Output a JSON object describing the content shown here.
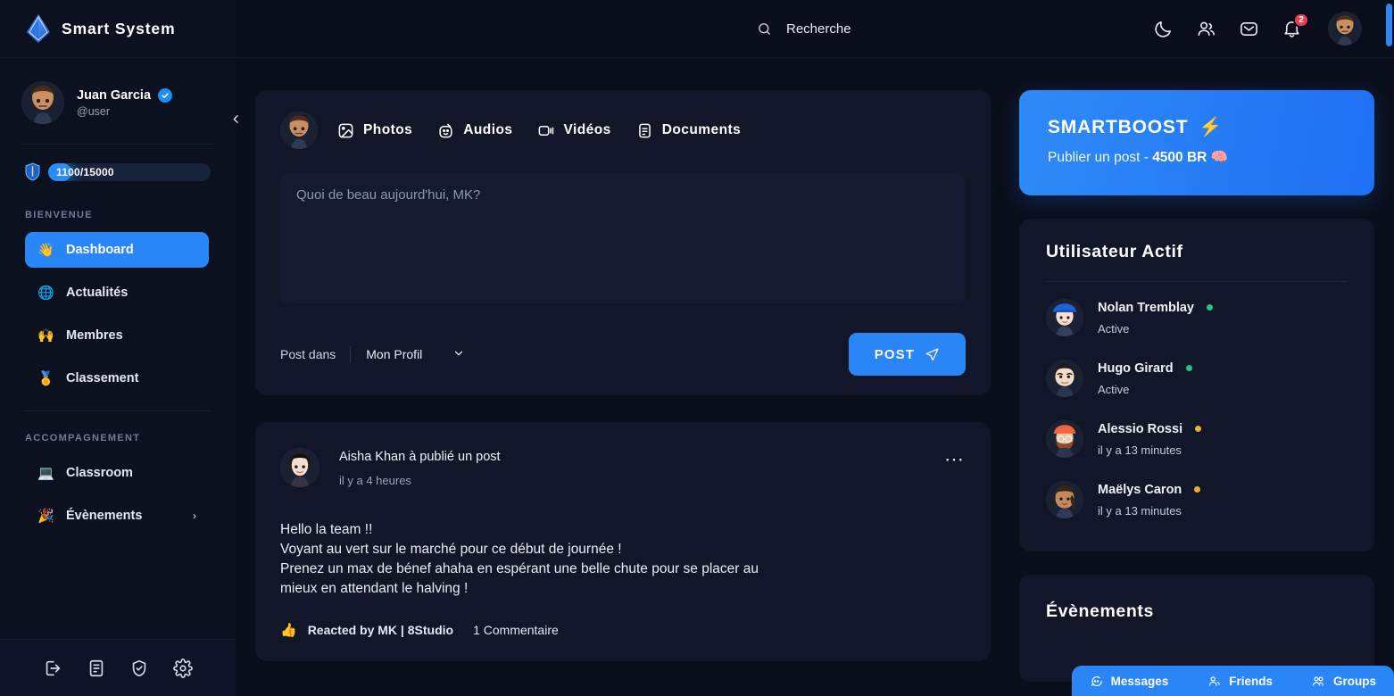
{
  "brand": {
    "name": "Smart System",
    "logo_icon": "diamond-crystal-icon"
  },
  "profile": {
    "name": "Juan Garcia",
    "handle": "@user",
    "verified_icon": "verified-check-icon",
    "avatar_icon": "user-avatar",
    "xp": {
      "icon": "shield-icon",
      "label": "1100/15000",
      "current": 1100,
      "max": 15000,
      "fill_color": "#2a8cf8"
    }
  },
  "sidebar": {
    "collapse_icon": "chevron-left-icon",
    "sections": [
      {
        "heading": "BIENVENUE",
        "items": [
          {
            "label": "Dashboard",
            "emoji": "👋",
            "icon": "wave-hand-icon",
            "active": true
          },
          {
            "label": "Actualités",
            "emoji": "🌐",
            "icon": "globe-icon",
            "active": false
          },
          {
            "label": "Membres",
            "emoji": "🙌",
            "icon": "raised-hands-icon",
            "active": false
          },
          {
            "label": "Classement",
            "emoji": "🏅",
            "icon": "medal-icon",
            "active": false
          }
        ]
      },
      {
        "heading": "ACCOMPAGNEMENT",
        "items": [
          {
            "label": "Classroom",
            "emoji": "💻",
            "icon": "laptop-icon",
            "active": false
          },
          {
            "label": "Évènements",
            "emoji": "🎉",
            "icon": "party-popper-icon",
            "active": false,
            "chevron": "›"
          }
        ]
      }
    ],
    "footer_icons": [
      "logout-icon",
      "document-icon",
      "shield-check-icon",
      "gear-icon"
    ]
  },
  "topbar": {
    "search": {
      "placeholder": "Recherche",
      "value": "",
      "icon": "search-icon"
    },
    "icons": [
      {
        "name": "moon-icon",
        "badge": ""
      },
      {
        "name": "friends-icon",
        "badge": ""
      },
      {
        "name": "mail-icon",
        "badge": ""
      },
      {
        "name": "bell-icon",
        "badge": "2"
      }
    ],
    "avatar_icon": "user-avatar"
  },
  "composer": {
    "avatar_icon": "user-avatar",
    "tabs": [
      {
        "label": "Photos",
        "icon": "image-icon"
      },
      {
        "label": "Audios",
        "icon": "audio-icon"
      },
      {
        "label": "Vidéos",
        "icon": "video-icon"
      },
      {
        "label": "Documents",
        "icon": "document-icon"
      }
    ],
    "textarea": {
      "placeholder": "Quoi de beau aujourd'hui, MK?",
      "value": ""
    },
    "post_in_label": "Post dans",
    "post_in_value": "Mon Profil",
    "post_in_chevron": "chevron-down-icon",
    "post_button": {
      "label": "POST",
      "icon": "send-icon",
      "color": "#2a85f7"
    }
  },
  "post": {
    "avatar_icon": "user-avatar",
    "title": "Aisha Khan à publié un post",
    "time": "il y a 4 heures",
    "menu_icon": "more-horizontal-icon",
    "body_lines": [
      "Hello la team !!",
      "Voyant au vert sur le marché pour ce début de journée !",
      "Prenez un max de bénef ahaha en espérant une belle chute pour se placer au",
      "mieux en attendant le halving !"
    ],
    "reaction_emoji": "👍",
    "reacted_by": "Reacted by MK | 8Studio",
    "comments": "1 Commentaire"
  },
  "boost": {
    "title": "SMARTBOOST",
    "title_emoji": "⚡",
    "subtitle_prefix": "Publier un post - ",
    "price": "4500 BR",
    "subtitle_emoji": "🧠",
    "color": "#2a85f7"
  },
  "active_users": {
    "title": "Utilisateur Actif",
    "items": [
      {
        "name": "Nolan Tremblay",
        "status": "Active",
        "dot_color": "#24c38e"
      },
      {
        "name": "Hugo Girard",
        "status": "Active",
        "dot_color": "#24c38e"
      },
      {
        "name": "Alessio Rossi",
        "status": "il y a 13 minutes",
        "dot_color": "#e8b030"
      },
      {
        "name": "Maëlys Caron",
        "status": "il y a 13 minutes",
        "dot_color": "#e8b030"
      }
    ]
  },
  "events": {
    "title": "Évènements"
  },
  "dock": {
    "items": [
      {
        "label": "Messages",
        "icon": "chat-icon"
      },
      {
        "label": "Friends",
        "icon": "friends-icon"
      },
      {
        "label": "Groups",
        "icon": "groups-icon"
      }
    ],
    "color": "#2a85f7"
  },
  "scrollbar": {
    "color": "#2a85f7"
  }
}
